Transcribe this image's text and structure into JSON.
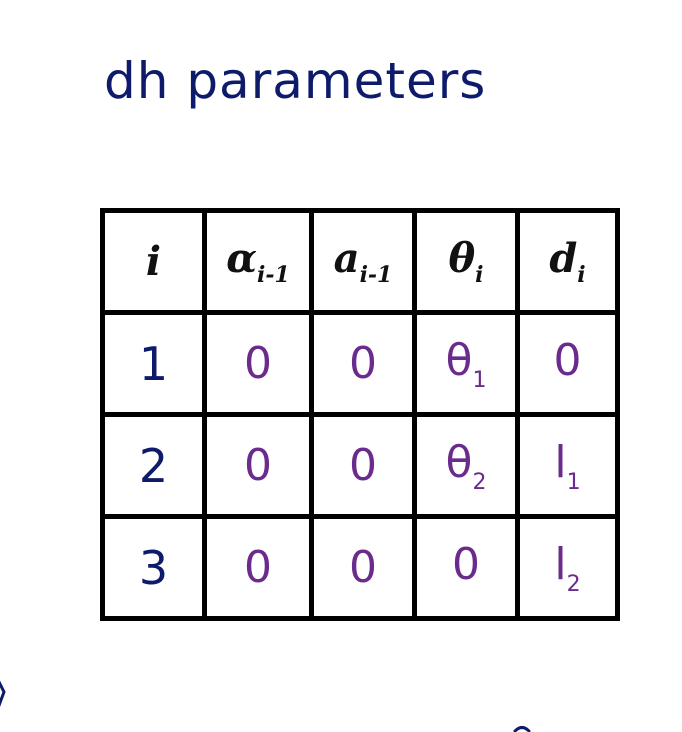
{
  "title": "dh parameters",
  "table": {
    "headers": [
      {
        "base": "i",
        "sub": ""
      },
      {
        "base": "α",
        "sub": "i-1"
      },
      {
        "base": "a",
        "sub": "i-1"
      },
      {
        "base": "θ",
        "sub": "i"
      },
      {
        "base": "d",
        "sub": "i"
      }
    ],
    "rows": [
      {
        "i": "1",
        "alpha": "0",
        "a": "0",
        "theta": {
          "base": "θ",
          "sub": "1"
        },
        "d": {
          "base": "0",
          "sub": ""
        }
      },
      {
        "i": "2",
        "alpha": "0",
        "a": "0",
        "theta": {
          "base": "θ",
          "sub": "2"
        },
        "d": {
          "base": "l",
          "sub": "1"
        }
      },
      {
        "i": "3",
        "alpha": "0",
        "a": "0",
        "theta": {
          "base": "0",
          "sub": ""
        },
        "d": {
          "base": "l",
          "sub": "2"
        }
      }
    ]
  },
  "colors": {
    "title_ink": "#0e1b6b",
    "value_ink": "#6a2b8c",
    "grid": "#000000"
  }
}
